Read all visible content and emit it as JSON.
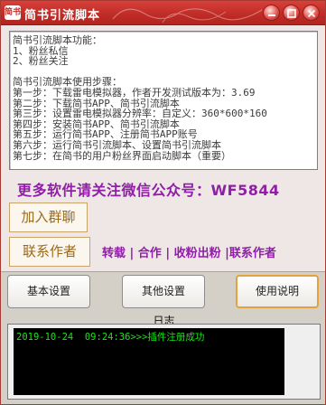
{
  "window": {
    "title": "简书引流脚本",
    "app_icon_text": "简书",
    "accent_color": "#c0302b"
  },
  "info": {
    "lines": [
      "简书引流脚本功能：",
      "1、粉丝私信",
      "2、粉丝关注",
      "",
      "简书引流脚本使用步骤：",
      "第一步：下载雷电模拟器，作者开发测试版本为：3.69",
      "第二步：下载简书APP、简书引流脚本",
      "第三步：设置雷电模拟器分辨率：自定义：360*600*160",
      "第四步：安装简书APP、简书引流脚本",
      "第五步：运行简书APP、注册简书APP账号",
      "第六步：运行简书引流脚本、设置简书引流脚本",
      "第七步：在简书的用户粉丝界面启动脚本（重要）"
    ]
  },
  "promo": {
    "text": "更多软件请关注微信公众号：WF5844",
    "color": "#8f1fa6"
  },
  "buttons": {
    "join_group": "加入群聊",
    "contact_author": "联系作者",
    "basic_settings": "基本设置",
    "other_settings": "其他设置",
    "instructions": "使用说明"
  },
  "links": {
    "text": "转载 | 合作 | 收粉出粉 |联系作者"
  },
  "log": {
    "label": "日志",
    "entries": [
      "2019-10-24  09:24:36>>>插件注册成功"
    ],
    "text_color": "#14e614"
  }
}
